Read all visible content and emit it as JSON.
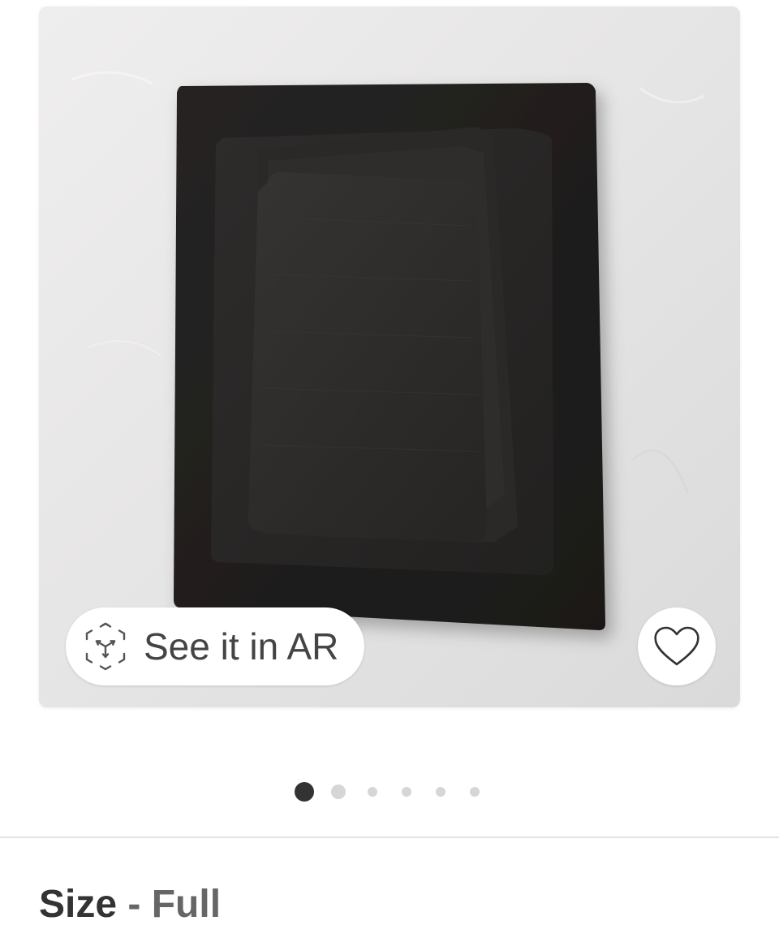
{
  "product_gallery": {
    "image_alt": "Stacked black linen sheet set",
    "ar_button_label": "See it in AR",
    "ar_icon": "ar-cube-icon",
    "favorite_icon": "heart-outline-icon",
    "total_images": 6,
    "active_image_index": 0
  },
  "variation": {
    "label": "Size",
    "separator": "-",
    "value": "Full"
  },
  "colors": {
    "background": "#ffffff",
    "active_dot": "#333333",
    "inactive_dot": "#d6d6d6",
    "fabric": "#1f1d1c",
    "text_primary": "#333333",
    "text_secondary": "#666666"
  }
}
